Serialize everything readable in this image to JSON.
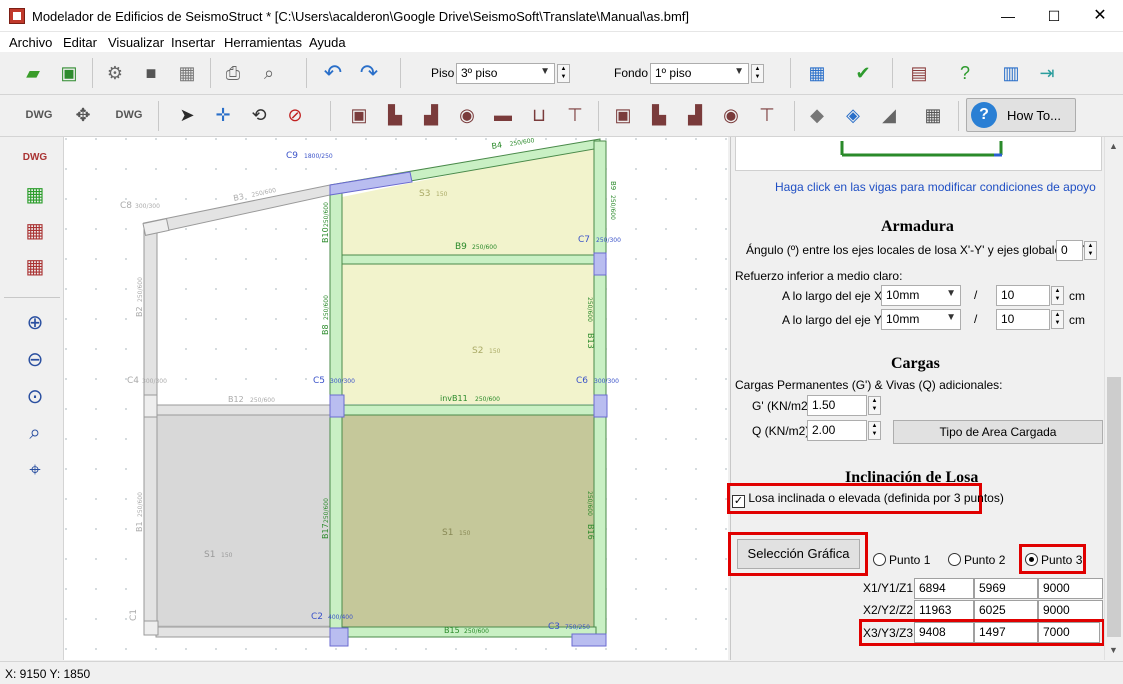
{
  "window": {
    "title": "Modelador de Edificios de SeismoStruct * [C:\\Users\\acalderon\\Google Drive\\SeismoSoft\\Translate\\Manual\\as.bmf]",
    "min": "—",
    "max": "☐",
    "close": "✕"
  },
  "menu": [
    "Archivo",
    "Editar",
    "Visualizar",
    "Insertar",
    "Herramientas",
    "Ayuda"
  ],
  "toolbar": {
    "piso_label": "Piso",
    "piso_value": "3º piso",
    "fondo_label": "Fondo",
    "fondo_value": "1º piso",
    "howto_label": "How To..."
  },
  "canvas_labels": {
    "C9": "C9",
    "C9_size": "1800/250",
    "B4": "B4",
    "B4_size": "250/600",
    "B3": "B3",
    "B3_size": "250/600",
    "C8": "C8",
    "C8_size": "300/300",
    "S3": "S3",
    "S3_val": "150",
    "B9v": "B9",
    "B9v_size": "250/600",
    "B10": "B10",
    "B10_size": "250/600",
    "C7": "C7",
    "C7_size": "250/300",
    "B9": "B9",
    "B9_size": "250/600",
    "B2": "B2",
    "B2_size": "250/600",
    "B8": "B8",
    "B8_size": "250/600",
    "S2": "S2",
    "S2_val": "150",
    "B13": "B13",
    "B13_size": "250/600",
    "C4": "C4",
    "C4_size": "300/300",
    "C5": "C5",
    "C5_size": "300/300",
    "C6": "C6",
    "C6_size": "300/300",
    "B12": "B12",
    "B12_size": "250/600",
    "invB11": "invB11",
    "invB11_size": "250/600",
    "B1": "B1",
    "B1_size": "250/600",
    "S1a": "S1",
    "S1a_val": "150",
    "B17": "B17",
    "B17_size": "250/600",
    "S1b": "S1",
    "S1b_val": "150",
    "B16": "B16",
    "B16_size": "250/600",
    "C1": "C1",
    "C2": "C2",
    "C2_size": "400/400",
    "C3": "C3",
    "C3_size": "750/250",
    "B15": "B15",
    "B15_size": "250/600"
  },
  "panel": {
    "hint": "Haga click en las vigas para modificar condiciones de apoyo",
    "armadura": "Armadura",
    "angle_label": "Ángulo (º) entre los ejes locales de losa X'-Y' y ejes globales X-Y",
    "angle_value": "0",
    "refuerzo_label": "Refuerzo inferior a medio claro:",
    "x_label": "A lo largo del eje X':",
    "x_bar": "10mm",
    "x_spacing": "10",
    "y_label": "A lo largo del eje Y':",
    "y_bar": "10mm",
    "y_spacing": "10",
    "slash": "/",
    "unit_cm": "cm",
    "cargas": "Cargas",
    "cargas_label": "Cargas Permanentes (G') & Vivas (Q) adicionales:",
    "g_label": "G' (KN/m2)",
    "g_value": "1.50",
    "q_label": "Q (KN/m2)",
    "q_value": "2.00",
    "tipo_area": "Tipo de Area Cargada",
    "inclinacion": "Inclinación de Losa",
    "losa_inclinada": "Losa inclinada o elevada (definida por 3 puntos)",
    "seleccion": "Selección Gráfica",
    "punto1": "Punto 1",
    "punto2": "Punto 2",
    "punto3": "Punto 3",
    "rows": [
      {
        "label": "X1/Y1/Z1:",
        "x": "6894",
        "y": "5969",
        "z": "9000"
      },
      {
        "label": "X2/Y2/Z2:",
        "x": "11963",
        "y": "6025",
        "z": "9000"
      },
      {
        "label": "X3/Y3/Z3:",
        "x": "9408",
        "y": "1497",
        "z": "7000"
      }
    ]
  },
  "status": "X: 9150  Y: 1850"
}
